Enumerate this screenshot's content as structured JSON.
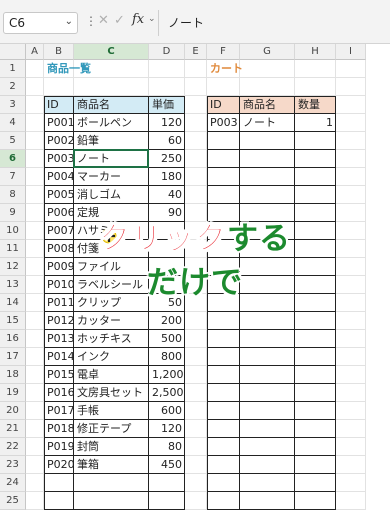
{
  "formula_bar": {
    "name_box": "C6",
    "formula": "ノート",
    "fx_label": "fx"
  },
  "columns": [
    "A",
    "B",
    "C",
    "D",
    "E",
    "F",
    "G",
    "H",
    "I"
  ],
  "rows": [
    "1",
    "2",
    "3",
    "4",
    "5",
    "6",
    "7",
    "8",
    "9",
    "10",
    "11",
    "12",
    "13",
    "14",
    "15",
    "16",
    "17",
    "18",
    "19",
    "20",
    "21",
    "22",
    "23",
    "24",
    "25"
  ],
  "selected_column": "C",
  "selected_row": "6",
  "product_section": {
    "title": "商品一覧",
    "headers": [
      "ID",
      "商品名",
      "単価"
    ],
    "rows": [
      {
        "id": "P001",
        "name": "ボールペン",
        "price": "120"
      },
      {
        "id": "P002",
        "name": "鉛筆",
        "price": "60"
      },
      {
        "id": "P003",
        "name": "ノート",
        "price": "250"
      },
      {
        "id": "P004",
        "name": "マーカー",
        "price": "180"
      },
      {
        "id": "P005",
        "name": "消しゴム",
        "price": "40"
      },
      {
        "id": "P006",
        "name": "定規",
        "price": "90"
      },
      {
        "id": "P007",
        "name": "ハサミ",
        "price": ""
      },
      {
        "id": "P008",
        "name": "付箋",
        "price": ""
      },
      {
        "id": "P009",
        "name": "ファイル",
        "price": ""
      },
      {
        "id": "P010",
        "name": "ラベルシール",
        "price": ""
      },
      {
        "id": "P011",
        "name": "クリップ",
        "price": "50"
      },
      {
        "id": "P012",
        "name": "カッター",
        "price": "200"
      },
      {
        "id": "P013",
        "name": "ホッチキス",
        "price": "500"
      },
      {
        "id": "P014",
        "name": "インク",
        "price": "800"
      },
      {
        "id": "P015",
        "name": "電卓",
        "price": "1,200"
      },
      {
        "id": "P016",
        "name": "文房具セット",
        "price": "2,500"
      },
      {
        "id": "P017",
        "name": "手帳",
        "price": "600"
      },
      {
        "id": "P018",
        "name": "修正テープ",
        "price": "120"
      },
      {
        "id": "P019",
        "name": "封筒",
        "price": "80"
      },
      {
        "id": "P020",
        "name": "筆箱",
        "price": "450"
      }
    ]
  },
  "cart_section": {
    "title": "カート",
    "headers": [
      "ID",
      "商品名",
      "数量"
    ],
    "rows": [
      {
        "id": "P003",
        "name": "ノート",
        "qty": "1"
      }
    ]
  },
  "overlay": {
    "line1_red": "クリック",
    "line1_green": "する",
    "line2": "だけで"
  },
  "colors": {
    "product_header_bg": "#d3ebf5",
    "cart_header_bg": "#f6d9c9",
    "product_title": "#3399bb",
    "cart_title": "#e08a3c",
    "selection": "#1e7145",
    "overlay_red": "#e8202a",
    "overlay_green": "#1c8a2e"
  }
}
